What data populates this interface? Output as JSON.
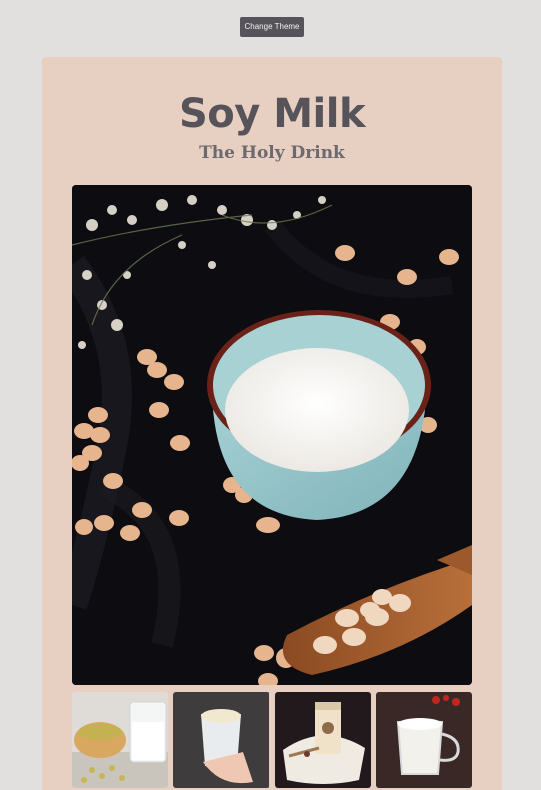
{
  "header": {
    "theme_button_label": "Change Theme"
  },
  "card": {
    "title": "Soy Milk",
    "subtitle": "The Holy Drink"
  },
  "gallery": {
    "hero_image": "bowl-of-soy-milk-photo",
    "thumbnails": [
      "glass-jar-and-soybeans-photo",
      "hand-holding-cup-photo",
      "bottle-on-plate-photo",
      "glass-mug-photo"
    ]
  }
}
